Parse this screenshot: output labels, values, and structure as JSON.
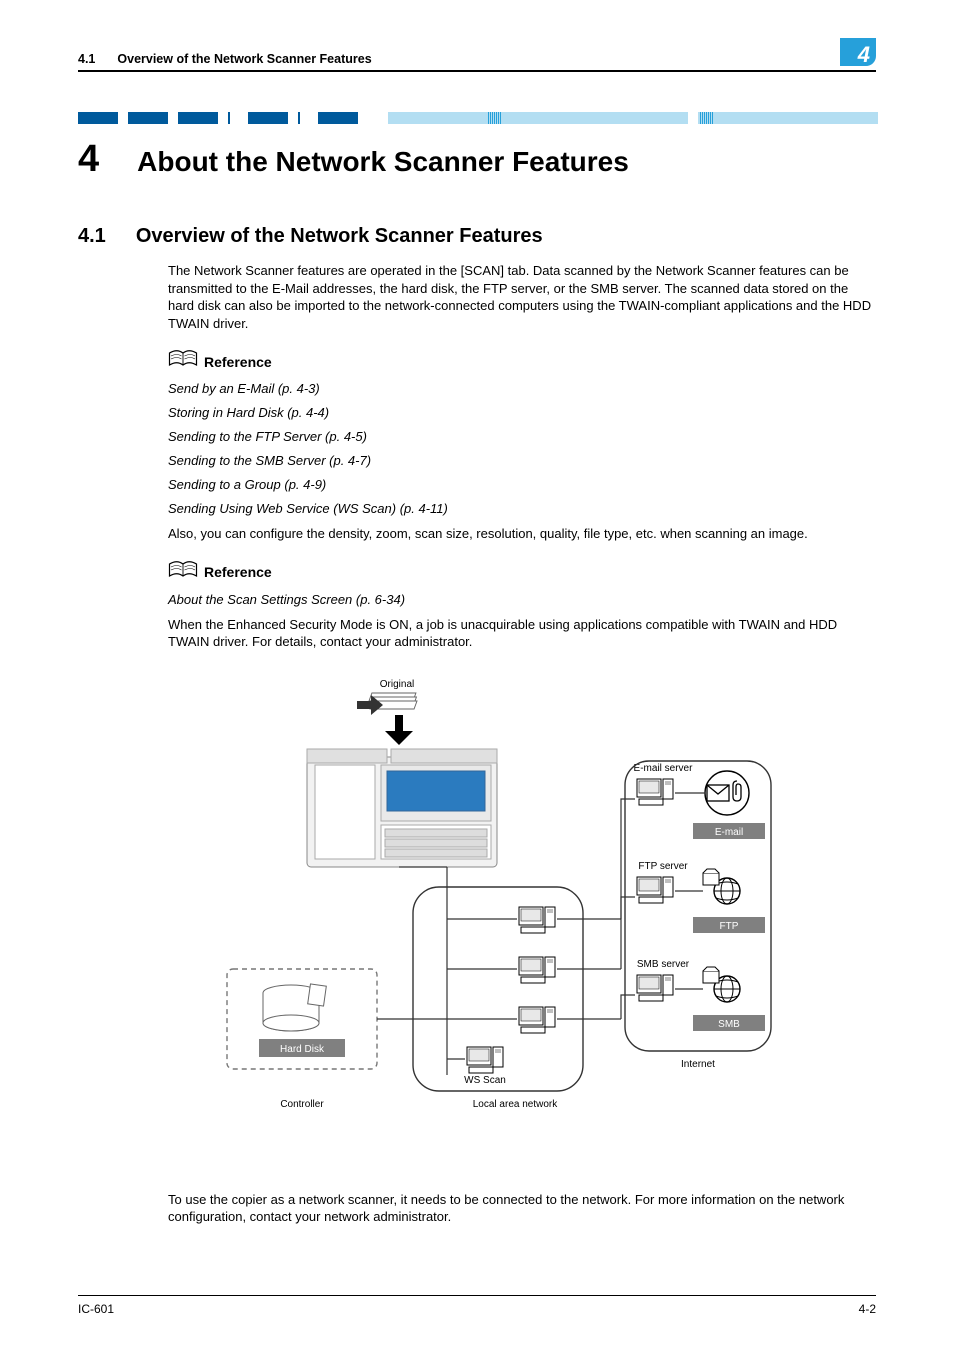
{
  "header": {
    "section_number": "4.1",
    "section_title": "Overview of the Network Scanner Features",
    "chapter_badge": "4"
  },
  "chapter": {
    "number": "4",
    "title": "About the Network Scanner Features"
  },
  "section": {
    "number": "4.1",
    "title": "Overview of the Network Scanner Features"
  },
  "intro_paragraph": "The Network Scanner features are operated in the [SCAN] tab. Data scanned by the Network Scanner features can be transmitted to the E-Mail addresses, the hard disk, the FTP server, or the SMB server.  The scanned data stored on the hard disk can also be imported to the network-connected computers using the TWAIN-compliant applications and the HDD TWAIN driver.",
  "reference_label": "Reference",
  "reference_list_1": [
    "Send by an E-Mail (p. 4-3)",
    "Storing in Hard Disk (p. 4-4)",
    "Sending to the FTP Server (p. 4-5)",
    "Sending to the SMB Server (p. 4-7)",
    "Sending to a Group (p. 4-9)",
    "Sending Using Web Service (WS Scan) (p. 4-11)"
  ],
  "post_ref1_paragraph": "Also, you can configure the density, zoom, scan size, resolution, quality, file type, etc. when scanning an image.",
  "reference_list_2": [
    "About the Scan Settings Screen (p. 6-34)"
  ],
  "post_ref2_paragraph": "When the Enhanced Security Mode is ON, a job is unacquirable using applications compatible with TWAIN and HDD TWAIN driver.  For details, contact your administrator.",
  "diagram": {
    "original": "Original",
    "email_server": "E-mail server",
    "email": "E-mail",
    "ftp_server": "FTP server",
    "ftp": "FTP",
    "smb_server": "SMB server",
    "smb": "SMB",
    "hard_disk": "Hard Disk",
    "ws_scan": "WS Scan",
    "internet": "Internet",
    "controller": "Controller",
    "lan": "Local area network"
  },
  "closing_paragraph": "To use the copier as a network scanner, it needs to be connected to the network.   For more information on the network configuration, contact your network administrator.",
  "footer": {
    "left": "IC-601",
    "right": "4-2"
  }
}
